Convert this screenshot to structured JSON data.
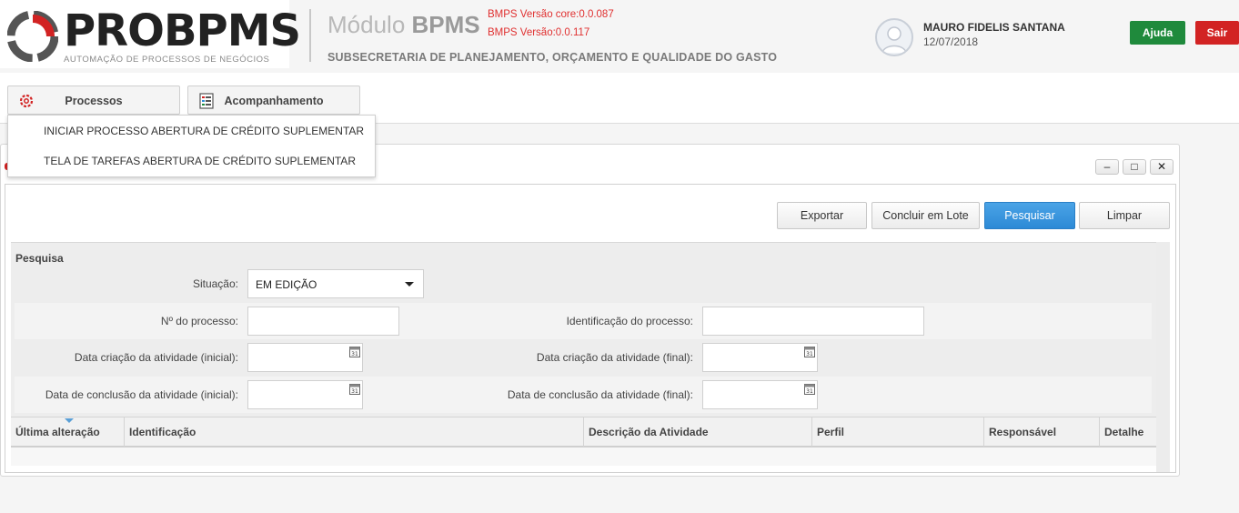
{
  "header": {
    "logo_pro": "PRO",
    "logo_bpms": "BPMS",
    "logo_subtitle": "AUTOMAÇÃO DE PROCESSOS DE NEGÓCIOS",
    "module_prefix": "Módulo",
    "module_name": "BPMS",
    "version_core": "BMPS Versão core:0.0.087",
    "version": "BMPS Versão:0.0.117",
    "subsecretaria": "SUBSECRETARIA DE PLANEJAMENTO, ORÇAMENTO E QUALIDADE DO GASTO",
    "user_name": "MAURO FIDELIS SANTANA",
    "date": "12/07/2018",
    "help_label": "Ajuda",
    "logout_label": "Sair"
  },
  "nav": {
    "tabs": [
      {
        "label": "Processos",
        "icon": "gear-icon"
      },
      {
        "label": "Acompanhamento",
        "icon": "checklist-icon"
      }
    ],
    "dropdown": [
      "INICIAR PROCESSO ABERTURA DE CRÉDITO SUPLEMENTAR",
      "TELA DE TAREFAS ABERTURA DE CRÉDITO SUPLEMENTAR"
    ]
  },
  "window_controls": {
    "minimize": "–",
    "maximize": "□",
    "close": "✕"
  },
  "toolbar": {
    "export_label": "Exportar",
    "batch_label": "Concluir em Lote",
    "search_label": "Pesquisar",
    "clear_label": "Limpar"
  },
  "search": {
    "title": "Pesquisa",
    "situacao_label": "Situação:",
    "situacao_value": "EM EDIÇÃO",
    "processo_label": "Nº do processo:",
    "identificacao_label": "Identificação do processo:",
    "criacao_inicial_label": "Data criação da atividade (inicial):",
    "criacao_final_label": "Data criação da atividade (final):",
    "conclusao_inicial_label": "Data de conclusão da atividade (inicial):",
    "conclusao_final_label": "Data de conclusão da atividade (final):"
  },
  "grid": {
    "columns": [
      "Última alteração",
      "Identificação",
      "Descrição da Atividade",
      "Perfil",
      "Responsável",
      "Detalhe"
    ]
  },
  "colors": {
    "accent_blue": "#2d8ad6",
    "help_green": "#1f8a3c",
    "logout_red": "#d22323",
    "version_red": "#e03030"
  }
}
